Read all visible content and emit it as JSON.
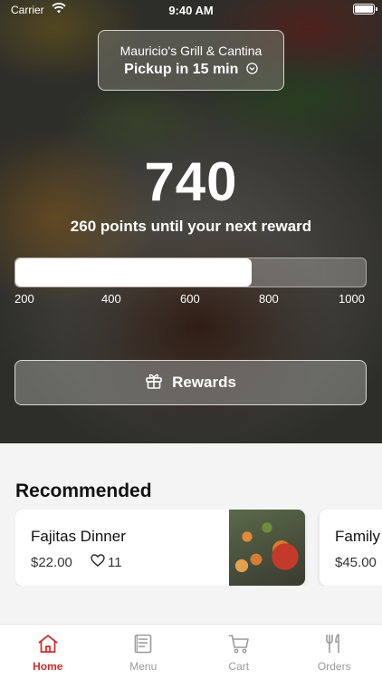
{
  "status_bar": {
    "carrier": "Carrier",
    "time": "9:40 AM"
  },
  "location": {
    "name": "Mauricio's Grill & Cantina",
    "pickup": "Pickup in 15 min"
  },
  "rewards": {
    "points": "740",
    "subtitle": "260 points until your next reward",
    "progress": {
      "min": 200,
      "max": 1000,
      "value": 740
    },
    "ticks": [
      "200",
      "400",
      "600",
      "800",
      "1000"
    ],
    "button_label": "Rewards"
  },
  "recommended": {
    "title": "Recommended",
    "items": [
      {
        "name": "Fajitas Dinner",
        "price": "$22.00",
        "favorites": "11"
      },
      {
        "name": "Family",
        "price": "$45.00"
      }
    ]
  },
  "tabs": [
    {
      "label": "Home",
      "icon": "home-icon",
      "active": true
    },
    {
      "label": "Menu",
      "icon": "menu-icon",
      "active": false
    },
    {
      "label": "Cart",
      "icon": "cart-icon",
      "active": false
    },
    {
      "label": "Orders",
      "icon": "orders-icon",
      "active": false
    }
  ],
  "colors": {
    "accent": "#d32f2f",
    "inactive": "#9a9a9a"
  }
}
